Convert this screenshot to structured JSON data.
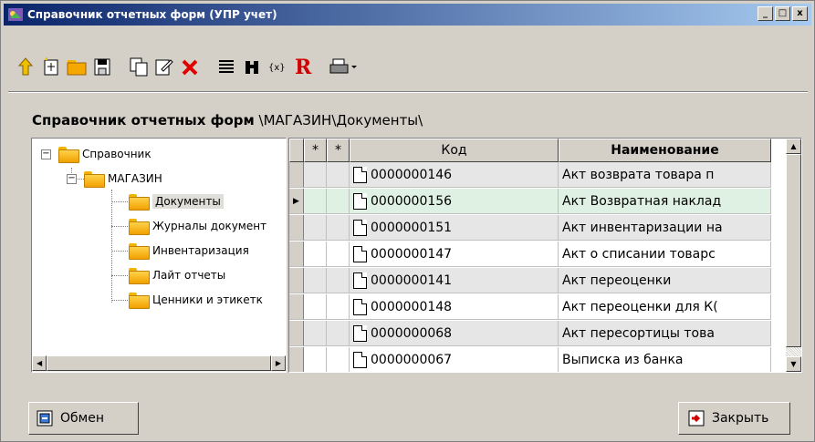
{
  "window": {
    "title": "Справочник отчетных форм (УПР учет)",
    "minimize_label": "_",
    "maximize_label": "□",
    "close_label": "x"
  },
  "toolbar": {
    "icons": [
      "arrow-up-icon",
      "new-item-icon",
      "folder-icon",
      "save-icon",
      "copy-icon",
      "edit-icon",
      "delete-icon",
      "list-icon",
      "binoculars-icon",
      "variables-icon",
      "report-r-icon",
      "print-icon"
    ]
  },
  "path": {
    "bold": "Справочник отчетных форм",
    "rest": " \\МАГАЗИН\\Документы\\"
  },
  "tree": {
    "root": "Справочник",
    "store": "МАГАЗИН",
    "children": [
      "Документы",
      "Журналы документ",
      "Инвентаризация",
      "Лайт отчеты",
      "Ценники и этикетк"
    ]
  },
  "grid": {
    "headers": {
      "star1": "*",
      "star2": "*",
      "code": "Код",
      "name": "Наименование"
    },
    "rows": [
      {
        "code": "0000000146",
        "name": "Акт возврата товара п"
      },
      {
        "code": "0000000156",
        "name": "Акт Возвратная наклад"
      },
      {
        "code": "0000000151",
        "name": "Акт инвентаризации на"
      },
      {
        "code": "0000000147",
        "name": "Акт о списании товарс"
      },
      {
        "code": "0000000141",
        "name": "Акт переоценки"
      },
      {
        "code": "0000000148",
        "name": "Акт переоценки для К("
      },
      {
        "code": "0000000068",
        "name": "Акт пересортицы това"
      },
      {
        "code": "0000000067",
        "name": "Выписка из банка"
      }
    ]
  },
  "buttons": {
    "exchange": "Обмен",
    "close": "Закрыть"
  },
  "colors": {
    "title_start": "#0a246a",
    "title_end": "#a6caf0",
    "selected_row": "#dff1e3",
    "alt_row": "#e6e6e6"
  }
}
